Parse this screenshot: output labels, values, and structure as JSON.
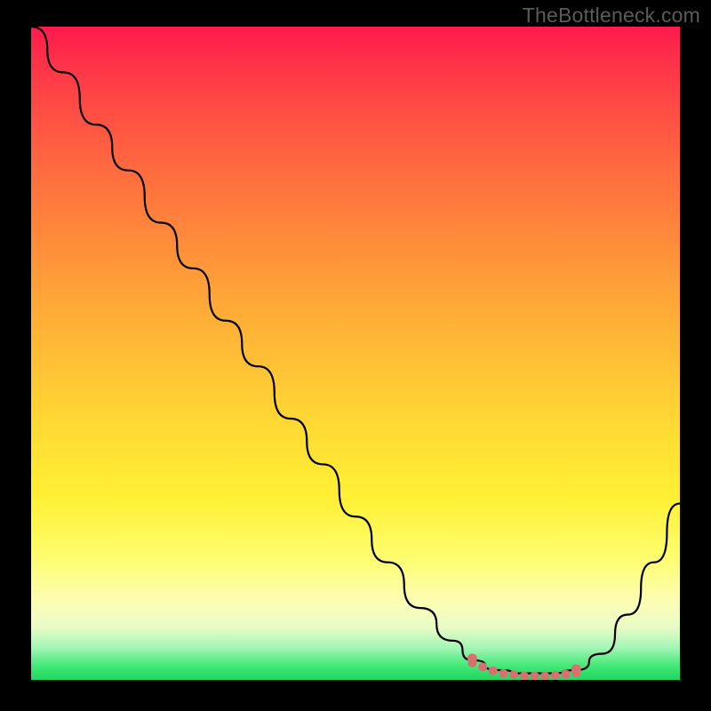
{
  "watermark": "TheBottleneck.com",
  "colors": {
    "page_bg": "#000000",
    "curve": "#000000",
    "band": "#d97070",
    "gradient_top": "#ff1a4d",
    "gradient_bottom": "#1fd661"
  },
  "chart_data": {
    "type": "line",
    "title": "",
    "xlabel": "",
    "ylabel": "",
    "xlim": [
      0,
      100
    ],
    "ylim": [
      0,
      100
    ],
    "grid": false,
    "legend": false,
    "background": "vertical-gradient red→green (bottleneck severity heatmap)",
    "x": [
      0,
      5,
      10,
      15,
      20,
      25,
      30,
      35,
      40,
      45,
      50,
      55,
      60,
      65,
      68,
      72,
      76,
      80,
      84,
      88,
      92,
      96,
      100
    ],
    "y": [
      100,
      93,
      85,
      78,
      70,
      63,
      55,
      48,
      40,
      33,
      25,
      18,
      11,
      6,
      3,
      1.5,
      1,
      1,
      1.5,
      4,
      10,
      18,
      27
    ],
    "optimal_band_x": [
      68,
      84
    ],
    "series_description": "Single black curve: steep monotone descent from top-left, reaching a flat minimum near x≈72-82, then rising again toward the right edge. Coral/salmon dotted band marks the flat bottom region (optimal / no-bottleneck zone)."
  }
}
